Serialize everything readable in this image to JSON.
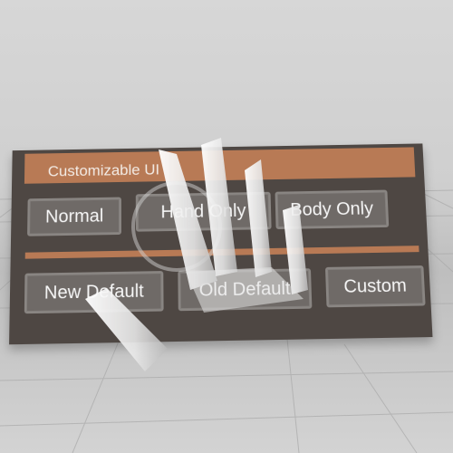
{
  "panel": {
    "title": "Customizable UI",
    "row1": [
      {
        "label": "Normal"
      },
      {
        "label": "Hand Only"
      },
      {
        "label": "Body Only"
      }
    ],
    "row2": [
      {
        "label": "New Default"
      },
      {
        "label": "Old Default"
      },
      {
        "label": "Custom"
      }
    ]
  },
  "colors": {
    "panel_bg": "#4e4743",
    "accent": "#b87a55",
    "button_bg": "#6f6a67",
    "text": "#f7f7f7"
  },
  "icons": [
    "hand-icon"
  ]
}
